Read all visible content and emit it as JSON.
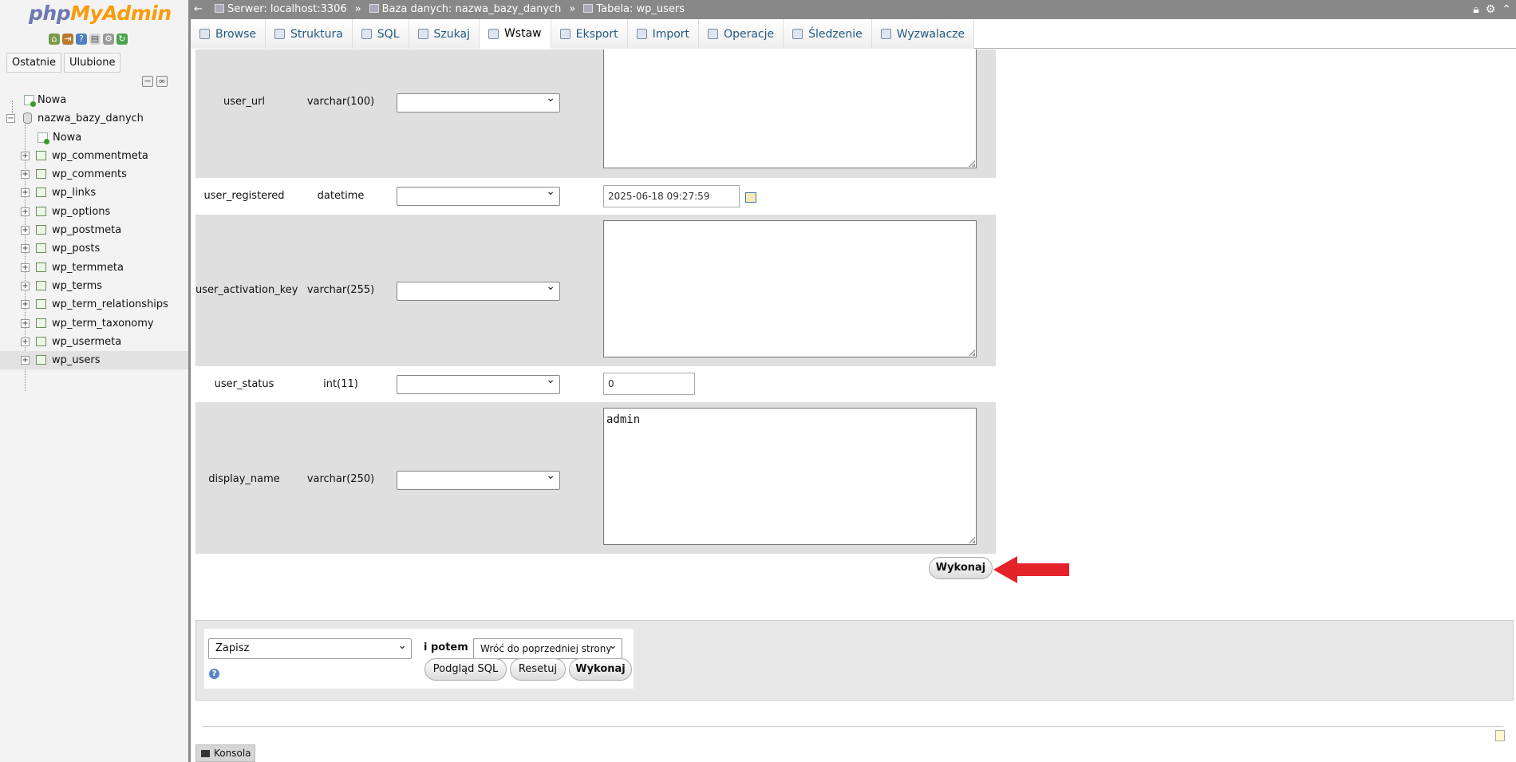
{
  "nav": {
    "logo_part1": "php",
    "logo_part2": "MyAdmin",
    "quick_icons": [
      "home-icon",
      "exit-icon",
      "help-icon",
      "docs-icon",
      "settings-icon",
      "reload-icon"
    ],
    "tabs": [
      "Ostatnie",
      "Ulubione"
    ],
    "tree": {
      "new_root": "Nowa",
      "database": "nazwa_bazy_danych",
      "new_table": "Nowa",
      "tables": [
        "wp_commentmeta",
        "wp_comments",
        "wp_links",
        "wp_options",
        "wp_postmeta",
        "wp_posts",
        "wp_termmeta",
        "wp_terms",
        "wp_term_relationships",
        "wp_term_taxonomy",
        "wp_usermeta",
        "wp_users"
      ],
      "selected": "wp_users"
    }
  },
  "topbar": {
    "back": "←",
    "server": "Serwer: localhost:3306",
    "database": "Baza danych: nazwa_bazy_danych",
    "table": "Tabela: wp_users",
    "sep": "»"
  },
  "tabs": [
    {
      "label": "Browse",
      "icon": "browse-icon"
    },
    {
      "label": "Struktura",
      "icon": "structure-icon"
    },
    {
      "label": "SQL",
      "icon": "sql-icon"
    },
    {
      "label": "Szukaj",
      "icon": "search-icon"
    },
    {
      "label": "Wstaw",
      "icon": "insert-icon",
      "active": true
    },
    {
      "label": "Eksport",
      "icon": "export-icon"
    },
    {
      "label": "Import",
      "icon": "import-icon"
    },
    {
      "label": "Operacje",
      "icon": "wrench-icon"
    },
    {
      "label": "Śledzenie",
      "icon": "eye-icon"
    },
    {
      "label": "Wyzwalacze",
      "icon": "trigger-icon"
    }
  ],
  "form": {
    "rows": [
      {
        "name": "user_url",
        "type": "varchar(100)",
        "value": ""
      },
      {
        "name": "user_registered",
        "type": "datetime",
        "value": "2025-06-18 09:27:59"
      },
      {
        "name": "user_activation_key",
        "type": "varchar(255)",
        "value": ""
      },
      {
        "name": "user_status",
        "type": "int(11)",
        "value": "0"
      },
      {
        "name": "display_name",
        "type": "varchar(250)",
        "value": "admin"
      }
    ],
    "submit": "Wykonaj"
  },
  "bottom": {
    "action_select": "Zapisz",
    "then_label": "i potem",
    "then_select": "Wróć do poprzedniej strony",
    "preview_sql": "Podgląd SQL",
    "reset": "Resetuj",
    "go": "Wykonaj"
  },
  "console": {
    "label": "Konsola"
  },
  "colors": {
    "accent_link": "#235a81",
    "arrow": "#e3222a",
    "logo_php": "#6c78af",
    "logo_myadmin": "#f89c0e"
  }
}
